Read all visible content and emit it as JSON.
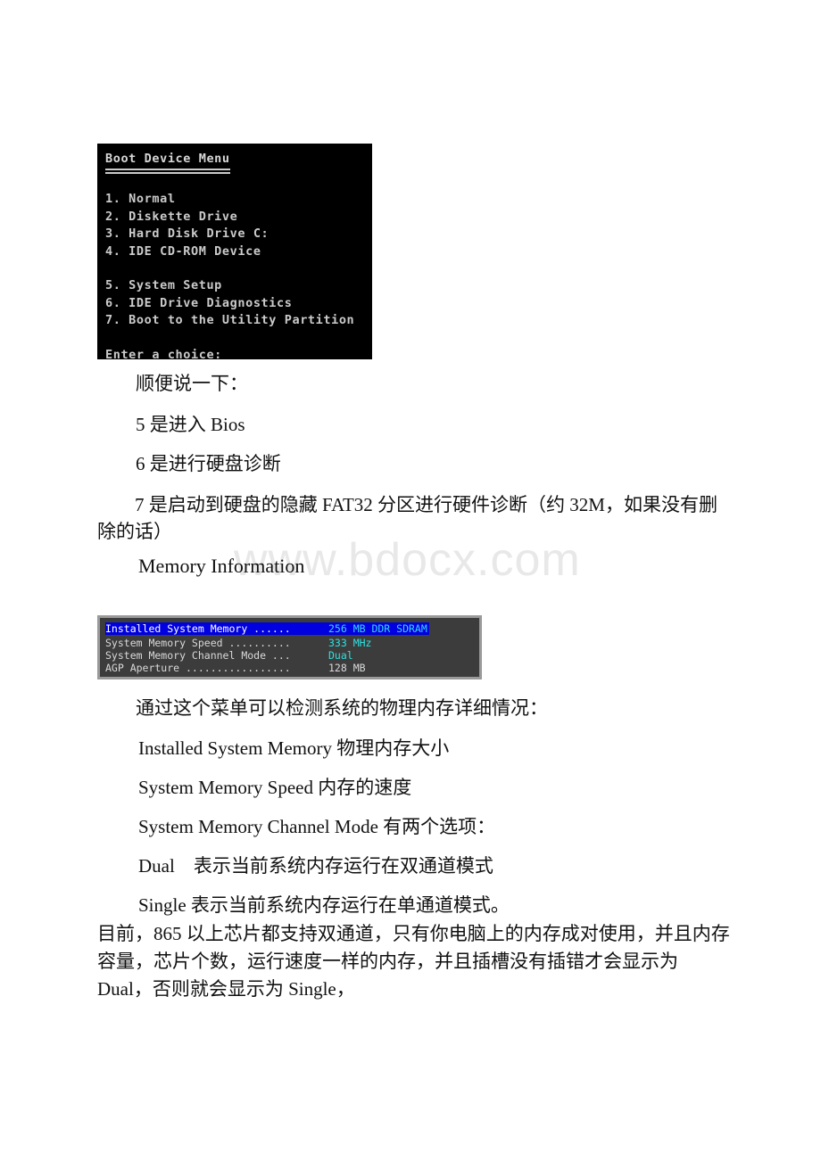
{
  "page": {
    "watermark": "www.bdocx.com"
  },
  "boot_menu": {
    "title": "Boot Device Menu",
    "items": [
      "1. Normal",
      "2. Diskette Drive",
      "3. Hard Disk Drive C:",
      "4. IDE CD-ROM Device"
    ],
    "items2": [
      "5. System Setup",
      "6. IDE Drive Diagnostics",
      "7. Boot to the Utility Partition"
    ],
    "prompt": "Enter a choice:"
  },
  "notes": {
    "intro": "顺便说一下：",
    "line5": "5 是进入 Bios",
    "line6": "6 是进行硬盘诊断",
    "line7": "7 是启动到硬盘的隐藏 FAT32 分区进行硬件诊断（约 32M，如果没有删除的话）"
  },
  "memory_heading": "Memory Information",
  "memory_panel": {
    "rows": [
      {
        "label": "Installed System Memory ......",
        "value": "256 MB DDR SDRAM",
        "highlighted": true,
        "value_color": "#3ad7f0"
      },
      {
        "label": "System Memory Speed ..........",
        "value": "333 MHz",
        "highlighted": false,
        "value_color": "#2fe0e0"
      },
      {
        "label": "System Memory Channel Mode ...",
        "value": "Dual",
        "highlighted": false,
        "value_color": "#2fe0e0"
      },
      {
        "label": "AGP Aperture .................",
        "value": "128 MB",
        "highlighted": false,
        "value_color": "#d9d9d9"
      }
    ],
    "highlight_bg": "#0000e0",
    "panel_bg": "#3c3c3c",
    "border_color": "#9a9a9a"
  },
  "memory_notes": {
    "intro": "通过这个菜单可以检测系统的物理内存详细情况：",
    "item1": "Installed System Memory 物理内存大小",
    "item2": "System Memory Speed 内存的速度",
    "item3": "System Memory Channel Mode 有两个选项：",
    "item4": "Dual    表示当前系统内存运行在双通道模式",
    "item5": "Single 表示当前系统内存运行在单通道模式。",
    "paragraph": "目前，865 以上芯片都支持双通道，只有你电脑上的内存成对使用，并且内存容量，芯片个数，运行速度一样的内存，并且插槽没有插错才会显示为 Dual，否则就会显示为 Single，"
  }
}
